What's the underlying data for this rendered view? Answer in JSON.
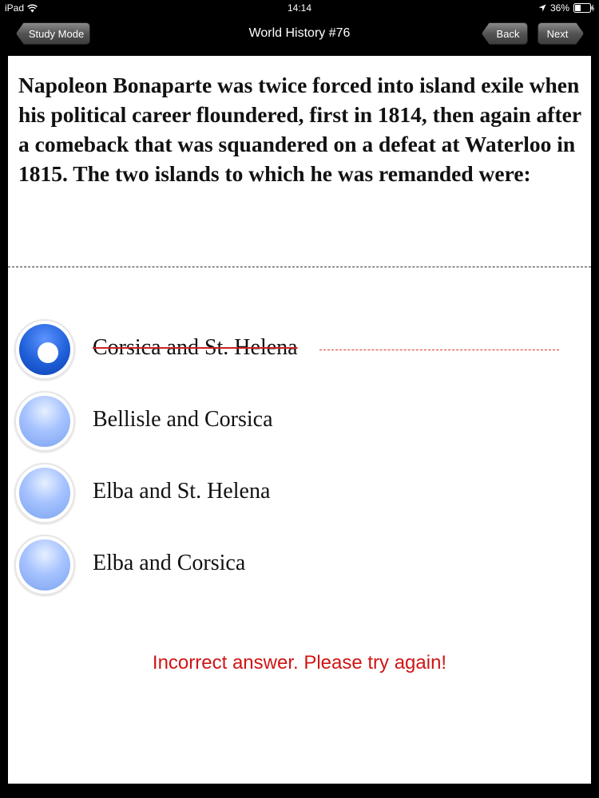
{
  "status_bar": {
    "device": "iPad",
    "time": "14:14",
    "battery": "36%"
  },
  "nav": {
    "title": "World History #76",
    "study_mode_label": "Study Mode",
    "back_label": "Back",
    "next_label": "Next"
  },
  "question": {
    "text": "Napoleon Bonaparte was twice forced into island exile when his political career floundered, first in 1814, then again after a comeback that was squandered on a defeat at Waterloo in 1815. The two islands to which he was remanded were:"
  },
  "answers": [
    {
      "label": "Corsica and St. Helena",
      "selected": true,
      "struck": true
    },
    {
      "label": "Bellisle and Corsica",
      "selected": false,
      "struck": false
    },
    {
      "label": "Elba and St. Helena",
      "selected": false,
      "struck": false
    },
    {
      "label": "Elba and Corsica",
      "selected": false,
      "struck": false
    }
  ],
  "feedback": {
    "text": "Incorrect answer. Please try again!",
    "color": "#d01515"
  },
  "colors": {
    "radio_selected": "#1e5fd8",
    "radio_unselected": "#a7c3ff",
    "strike": "#cc2222"
  }
}
